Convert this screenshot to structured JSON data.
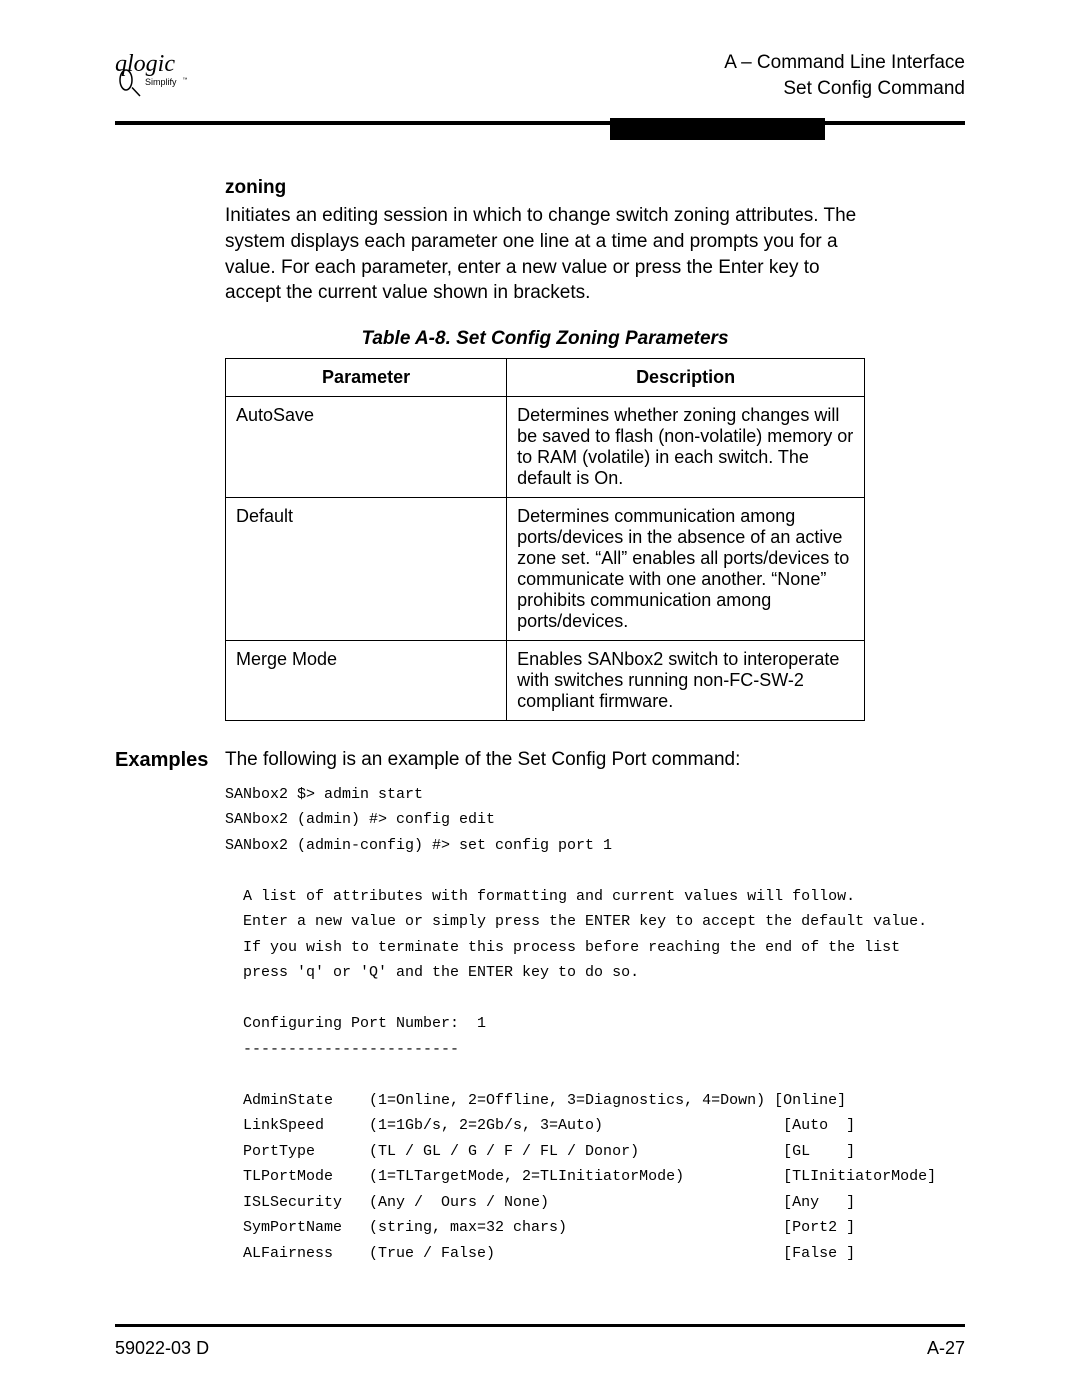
{
  "header": {
    "line1": "A – Command Line Interface",
    "line2": "Set Config Command"
  },
  "section": {
    "title": "zoning",
    "body": "Initiates an editing session in which to change switch zoning attributes. The system displays each parameter one line at a time and prompts you for a value. For each parameter, enter a new value or press the Enter key to accept the current value shown in brackets."
  },
  "table": {
    "caption": "Table A-8. Set Config Zoning Parameters",
    "headers": {
      "col1": "Parameter",
      "col2": "Description"
    },
    "rows": [
      {
        "param": "AutoSave",
        "desc": "Determines whether zoning changes will be saved to flash (non-volatile) memory or to RAM (volatile) in each switch. The default is On."
      },
      {
        "param": "Default",
        "desc": "Determines communication among ports/devices in the absence of an active zone set. “All” enables all ports/devices to communicate with one another. “None” prohibits communication among ports/devices."
      },
      {
        "param": "Merge Mode",
        "desc": "Enables SANbox2 switch to interoperate with switches running non-FC-SW-2 compliant firmware."
      }
    ]
  },
  "examples": {
    "label": "Examples",
    "intro": "The following is an example of the Set Config Port command:",
    "code": "SANbox2 $> admin start\nSANbox2 (admin) #> config edit\nSANbox2 (admin-config) #> set config port 1\n\n  A list of attributes with formatting and current values will follow.\n  Enter a new value or simply press the ENTER key to accept the default value.\n  If you wish to terminate this process before reaching the end of the list\n  press 'q' or 'Q' and the ENTER key to do so.\n\n  Configuring Port Number:  1\n  ------------------------\n\n  AdminState    (1=Online, 2=Offline, 3=Diagnostics, 4=Down) [Online]\n  LinkSpeed     (1=1Gb/s, 2=2Gb/s, 3=Auto)                    [Auto  ]\n  PortType      (TL / GL / G / F / FL / Donor)                [GL    ]\n  TLPortMode    (1=TLTargetMode, 2=TLInitiatorMode)           [TLInitiatorMode]\n  ISLSecurity   (Any /  Ours / None)                          [Any   ]\n  SymPortName   (string, max=32 chars)                        [Port2 ]\n  ALFairness    (True / False)                                [False ]"
  },
  "footer": {
    "left": "59022-03  D",
    "right": "A-27"
  },
  "logo": {
    "brand": "qlogic",
    "tag": "Simplify"
  }
}
